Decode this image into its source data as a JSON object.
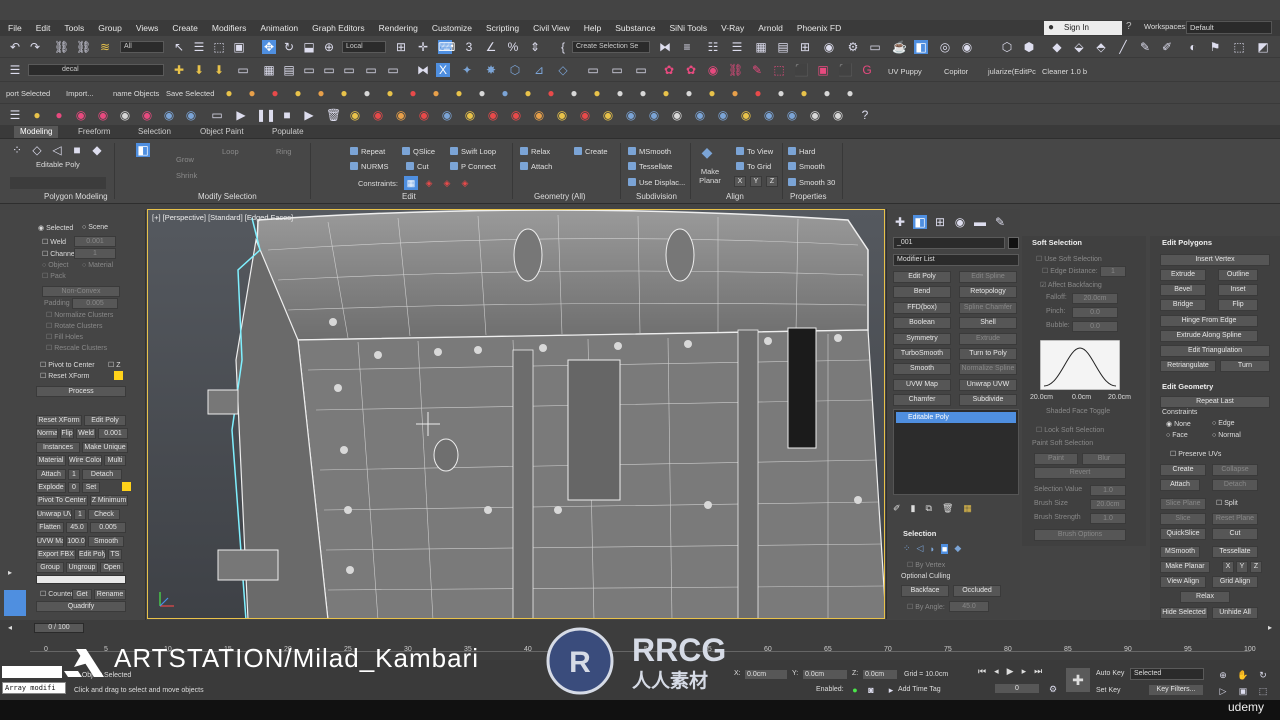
{
  "menu": [
    "File",
    "Edit",
    "Tools",
    "Group",
    "Views",
    "Create",
    "Modifiers",
    "Animation",
    "Graph Editors",
    "Rendering",
    "Customize",
    "Scripting",
    "Civil View",
    "Help",
    "Substance",
    "SiNi Tools",
    "V-Ray",
    "Arnold",
    "Phoenix FD"
  ],
  "header": {
    "sign_in": "Sign In",
    "workspaces_label": "Workspaces:",
    "workspace_value": "Default"
  },
  "toolbar1": {
    "selection_filter": "All",
    "reference_coord": "Local",
    "named_selection": "Create Selection Se"
  },
  "toolbar2": {
    "layer_value": "decal",
    "scripts": [
      "UV Puppy",
      "Copitor",
      "jularize(EditPc",
      "Cleaner 1.0 b"
    ]
  },
  "toolbar3": {
    "buttons": [
      "port Selected",
      "Import...",
      "name Objects",
      "Save Selected"
    ]
  },
  "ribbon": {
    "tabs": [
      "Modeling",
      "Freeform",
      "Selection",
      "Object Paint",
      "Populate"
    ],
    "editable_poly": "Editable Poly",
    "sections": [
      "Polygon Modeling",
      "Modify Selection",
      "Edit",
      "Geometry (All)",
      "Subdivision",
      "Align",
      "Properties"
    ],
    "modsel": [
      "Grow",
      "Shrink",
      "Loop",
      "Ring"
    ],
    "edit": [
      "Repeat",
      "QSlice",
      "Swift Loop",
      "NURMS",
      "Cut",
      "P Connect"
    ],
    "constraints": "Constraints:",
    "geometry": [
      "Relax",
      "Create",
      "Attach"
    ],
    "subdivision": [
      "MSmooth",
      "Tessellate",
      "Use Displac..."
    ],
    "align": [
      "Make Planar",
      "To View",
      "To Grid"
    ],
    "xyz": [
      "X",
      "Y",
      "Z"
    ],
    "properties": [
      "Hard",
      "Smooth",
      "Smooth 30"
    ]
  },
  "leftpanel": {
    "selected": "Selected",
    "scene": "Scene",
    "weld": "Weld",
    "weld_val": "0.001",
    "channel": "Channel",
    "channel_val": "1",
    "object": "Object",
    "material": "Material",
    "pack": "Pack",
    "nonconvex": "Non-Convex",
    "padding": "Padding",
    "padding_val": "0.005",
    "normalize": "Normalize Clusters",
    "rotate": "Rotate Clusters",
    "fill": "Fill Holes",
    "rescale": "Rescale Clusters",
    "pivot": "Pivot to Center",
    "z": "Z",
    "reset": "Reset XForm",
    "process": "Process",
    "grid": [
      [
        "Reset XForm",
        "Edit Poly"
      ],
      [
        "Normal",
        "Flip",
        "Weld",
        "0.001"
      ],
      [
        "Instances",
        "Make Unique"
      ],
      [
        "Material",
        "Wire Color",
        "Multi"
      ],
      [
        "Attach",
        "1",
        "Detach"
      ],
      [
        "Explode",
        "0",
        "Set"
      ],
      [
        "Pivot To Center",
        "Z Minimum"
      ],
      [
        "Unwrap UVW",
        "1",
        "Check"
      ],
      [
        "Flatten",
        "45.0",
        "0.005"
      ],
      [
        "UVW Map",
        "100.0",
        "Smooth"
      ],
      [
        "Export FBX",
        "Edit Poly",
        "TS"
      ],
      [
        "Group",
        "Ungroup",
        "Open"
      ]
    ],
    "counter": "Counter",
    "get": "Get",
    "rename": "Rename",
    "quadrify": "Quadrify"
  },
  "viewport": {
    "label": "[+] [Perspective] [Standard] [Edged Faces]"
  },
  "cmdpanel": {
    "object_name": "_001",
    "modifier_list": "Modifier List",
    "modifiers": [
      [
        "Edit Poly",
        "Edit Spline"
      ],
      [
        "Bend",
        "Retopology"
      ],
      [
        "FFD(box)",
        "Spline Chamfer"
      ],
      [
        "Boolean",
        "Shell"
      ],
      [
        "Symmetry",
        "Extrude"
      ],
      [
        "TurboSmooth",
        "Turn to Poly"
      ],
      [
        "Smooth",
        "Normalize Spline"
      ],
      [
        "UVW Map",
        "Unwrap UVW"
      ],
      [
        "Chamfer",
        "Subdivide"
      ]
    ],
    "stack_item": "Editable Poly",
    "selection_head": "Selection",
    "by_vertex": "By Vertex",
    "optional_culling": "Optional Culling",
    "backface": "Backface",
    "occluded": "Occluded",
    "by_angle": "By Angle:",
    "by_angle_val": "45.0"
  },
  "softsel": {
    "head": "Soft Selection",
    "use": "Use Soft Selection",
    "edge_dist": "Edge Distance:",
    "edge_val": "1",
    "affect": "Affect Backfacing",
    "falloff": "Falloff:",
    "falloff_val": "20.0cm",
    "pinch": "Pinch:",
    "pinch_val": "0.0",
    "bubble": "Bubble:",
    "bubble_val": "0.0",
    "curve_labels": [
      "20.0cm",
      "0.0cm",
      "20.0cm"
    ],
    "shaded": "Shaded Face Toggle",
    "lock": "Lock Soft Selection",
    "paint_head": "Paint Soft Selection",
    "paint": "Paint",
    "blur": "Blur",
    "revert": "Revert",
    "sel_value": "Selection Value",
    "sel_val": "1.0",
    "brush_size": "Brush Size",
    "brush_size_val": "20.0cm",
    "brush_strength": "Brush Strength",
    "brush_strength_val": "1.0",
    "brush_options": "Brush Options"
  },
  "editpoly": {
    "head": "Edit Polygons",
    "insert_vertex": "Insert Vertex",
    "pairs": [
      [
        "Extrude",
        "Outline"
      ],
      [
        "Bevel",
        "Inset"
      ],
      [
        "Bridge",
        "Flip"
      ]
    ],
    "hinge": "Hinge From Edge",
    "extrude_spline": "Extrude Along Spline",
    "edit_tri": "Edit Triangulation",
    "retri": "Retriangulate",
    "turn": "Turn",
    "geo_head": "Edit Geometry",
    "repeat_last": "Repeat Last",
    "constraints": "Constraints",
    "none": "None",
    "edge": "Edge",
    "face": "Face",
    "normal": "Normal",
    "preserve": "Preserve UVs",
    "create": "Create",
    "collapse": "Collapse",
    "attach": "Attach",
    "detach": "Detach",
    "slice_plane": "Slice Plane",
    "split": "Split",
    "slice": "Slice",
    "reset_plane": "Reset Plane",
    "quickslice": "QuickSlice",
    "cut": "Cut",
    "msmooth": "MSmooth",
    "tessellate": "Tessellate",
    "make_planar": "Make Planar",
    "x": "X",
    "y": "Y",
    "z": "Z",
    "view_align": "View Align",
    "grid_align": "Grid Align",
    "relax": "Relax",
    "hide_sel": "Hide Selected",
    "unhide": "Unhide All"
  },
  "timeline": {
    "frame": "0 / 100",
    "ticks": [
      "0",
      "5",
      "10",
      "15",
      "20",
      "25",
      "30",
      "35",
      "40",
      "45",
      "50",
      "55",
      "60",
      "65",
      "70",
      "75",
      "80",
      "85",
      "90",
      "95",
      "100"
    ]
  },
  "status": {
    "selected": "1 Object Selected",
    "hint": "Click and drag to select and move objects",
    "script": "Array modifi",
    "x": "0.0cm",
    "y": "0.0cm",
    "z": "0.0cm",
    "grid": "Grid = 10.0cm",
    "enabled": "Enabled:",
    "add_time_tag": "Add Time Tag",
    "auto_key": "Auto Key",
    "set_key": "Set Key",
    "key_sel": "Selected",
    "key_filters": "Key Filters...",
    "frame_val": "0"
  },
  "watermark": {
    "artstation": "ARTSTATION/Milad_Kambari",
    "rrcg": "RRCG",
    "cn": "人人素材",
    "udemy": "udemy"
  },
  "colors": {
    "accent": "#4f8fe0",
    "highlight": "#ffd21a",
    "viewport_border": "#e8c24a"
  }
}
